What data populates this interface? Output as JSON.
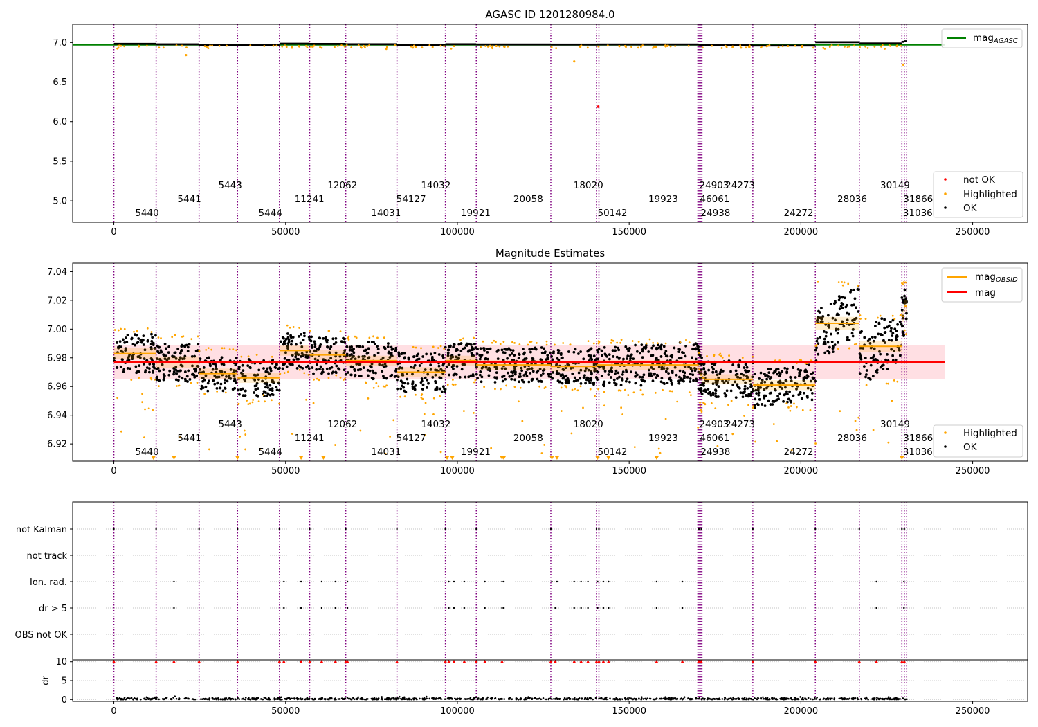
{
  "colors": {
    "ok": "#000000",
    "highlighted": "#ffa500",
    "not_ok": "#ff0000",
    "agasc_line": "#008000",
    "mean_line": "#ff0000",
    "band": "#ffc0c8",
    "obs_line": "#800080",
    "obsid_mag": "#ffa500"
  },
  "chart_data": [
    {
      "type": "scatter",
      "title": "AGASC ID 1201280984.0",
      "xlim": [
        -12000,
        266000
      ],
      "ylim": [
        4.73,
        7.23
      ],
      "xticks": [
        0,
        50000,
        100000,
        150000,
        200000,
        250000
      ],
      "yticks": [
        5.0,
        5.5,
        6.0,
        6.5,
        7.0
      ],
      "ytick_labels": [
        "5.0",
        "5.5",
        "6.0",
        "6.5",
        "7.0"
      ],
      "grid": false,
      "mag_agasc": 6.97,
      "legend_top": {
        "placement": "upper right",
        "entries": [
          "mag_AGASC"
        ],
        "main": "mag",
        "sub": "AGASC"
      },
      "legend_bottom": {
        "placement": "lower right",
        "entries": [
          "not OK",
          "Highlighted",
          "OK"
        ]
      },
      "outlier_not_ok": {
        "x": 141000,
        "y": 6.19
      }
    },
    {
      "type": "scatter",
      "title": "Magnitude Estimates",
      "xlim": [
        -12000,
        266000
      ],
      "ylim": [
        6.908,
        7.046
      ],
      "xticks": [
        0,
        50000,
        100000,
        150000,
        200000,
        250000
      ],
      "yticks": [
        6.92,
        6.94,
        6.96,
        6.98,
        7.0,
        7.02,
        7.04
      ],
      "ytick_labels": [
        "6.92",
        "6.94",
        "6.96",
        "6.98",
        "7.00",
        "7.02",
        "7.04"
      ],
      "grid": false,
      "mag_mean": 6.977,
      "mag_band": [
        6.965,
        6.989
      ],
      "legend_top": {
        "placement": "upper right",
        "entries": [
          "mag_OBSID",
          "mag"
        ],
        "main": "mag",
        "sub": "OBSID",
        "second": "mag"
      },
      "legend_bottom": {
        "placement": "lower right",
        "entries": [
          "Highlighted",
          "OK"
        ]
      },
      "segments": [
        {
          "obsid": "5440",
          "x0": 0,
          "x1": 12300,
          "mean": 6.983,
          "spread": 0.008,
          "upper": 6.998,
          "lower": 6.968,
          "tilt": 0
        },
        {
          "obsid": "5441",
          "x0": 12300,
          "x1": 24800,
          "mean": 6.977,
          "spread": 0.008,
          "upper": 6.993,
          "lower": 6.963,
          "tilt": 0
        },
        {
          "obsid": "5443",
          "x0": 24800,
          "x1": 36000,
          "mean": 6.969,
          "spread": 0.007,
          "upper": 6.984,
          "lower": 6.957,
          "tilt": 0
        },
        {
          "obsid": "5444",
          "x0": 36000,
          "x1": 48200,
          "mean": 6.966,
          "spread": 0.007,
          "upper": 6.98,
          "lower": 6.951,
          "tilt": 0
        },
        {
          "obsid": "11241",
          "x0": 48200,
          "x1": 57000,
          "mean": 6.985,
          "spread": 0.007,
          "upper": 7.0,
          "lower": 6.972,
          "tilt": 0
        },
        {
          "obsid": "12062",
          "x0": 57000,
          "x1": 67500,
          "mean": 6.982,
          "spread": 0.007,
          "upper": 6.997,
          "lower": 6.968,
          "tilt": 0
        },
        {
          "obsid": "14031",
          "x0": 67500,
          "x1": 82400,
          "mean": 6.978,
          "spread": 0.007,
          "upper": 6.992,
          "lower": 6.963,
          "tilt": 0
        },
        {
          "obsid": "14032",
          "x0": 82400,
          "x1": 96500,
          "mean": 6.97,
          "spread": 0.007,
          "upper": 6.986,
          "lower": 6.955,
          "tilt": 0
        },
        {
          "obsid": "19921",
          "x0": 96500,
          "x1": 105500,
          "mean": 6.978,
          "spread": 0.007,
          "upper": 6.992,
          "lower": 6.965,
          "tilt": 0
        },
        {
          "obsid": "20058",
          "x0": 105500,
          "x1": 127200,
          "mean": 6.975,
          "spread": 0.007,
          "upper": 6.989,
          "lower": 6.962,
          "tilt": 0
        },
        {
          "obsid": "18020",
          "x0": 127200,
          "x1": 140500,
          "mean": 6.974,
          "spread": 0.007,
          "upper": 6.989,
          "lower": 6.961,
          "tilt": 0
        },
        {
          "obsid": "50142",
          "x0": 140500,
          "x1": 141200,
          "mean": 6.975,
          "spread": 0.007,
          "upper": 6.989,
          "lower": 6.962,
          "tilt": 0
        },
        {
          "obsid": "19923",
          "x0": 141200,
          "x1": 170200,
          "mean": 6.975,
          "spread": 0.007,
          "upper": 6.99,
          "lower": 6.958,
          "tilt": -0.004
        },
        {
          "obsid": "24903",
          "x0": 170200,
          "x1": 170700,
          "mean": 6.972,
          "spread": 0.007,
          "upper": 6.982,
          "lower": 6.95,
          "tilt": 0
        },
        {
          "obsid": "46061",
          "x0": 170700,
          "x1": 171200,
          "mean": 6.968,
          "spread": 0.007,
          "upper": 6.975,
          "lower": 6.945,
          "tilt": 0
        },
        {
          "obsid": "24938",
          "x0": 171200,
          "x1": 172000,
          "mean": 6.966,
          "spread": 0.007,
          "upper": 6.975,
          "lower": 6.95,
          "tilt": 0
        },
        {
          "obsid": "24273",
          "x0": 172000,
          "x1": 186000,
          "mean": 6.965,
          "spread": 0.007,
          "upper": 6.98,
          "lower": 6.951,
          "tilt": 0
        },
        {
          "obsid": "24272",
          "x0": 186000,
          "x1": 204200,
          "mean": 6.961,
          "spread": 0.007,
          "upper": 6.976,
          "lower": 6.947,
          "tilt": -0.006
        },
        {
          "obsid": "28036",
          "x0": 204200,
          "x1": 217000,
          "mean": 7.004,
          "spread": 0.009,
          "upper": 7.03,
          "lower": 6.99,
          "tilt": -0.02
        },
        {
          "obsid": "30149",
          "x0": 217000,
          "x1": 229400,
          "mean": 6.988,
          "spread": 0.008,
          "upper": 7.007,
          "lower": 6.965,
          "tilt": -0.018
        },
        {
          "obsid": "31866",
          "x0": 229400,
          "x1": 230100,
          "mean": 7.009,
          "spread": 0.008,
          "upper": 7.03,
          "lower": 6.998,
          "tilt": 0
        },
        {
          "obsid": "31036",
          "x0": 230100,
          "x1": 230800,
          "mean": 7.016,
          "spread": 0.008,
          "upper": 7.032,
          "lower": 7.0,
          "tilt": 0
        }
      ]
    },
    {
      "type": "scatter",
      "title": "",
      "xlim": [
        -12000,
        266000
      ],
      "xticks": [
        0,
        50000,
        100000,
        150000,
        200000,
        250000
      ],
      "grid": true,
      "flags": [
        "not Kalman",
        "not track",
        "Ion. rad.",
        "dr > 5",
        "OBS not OK"
      ],
      "flag_points": {
        "not Kalman": [
          0,
          12300,
          24800,
          36000,
          48200,
          57000,
          67500,
          82400,
          96500,
          105500,
          127200,
          140500,
          141200,
          170200,
          170500,
          171000,
          186000,
          204200,
          217000,
          229400,
          230100
        ],
        "not track": [],
        "Ion. rad.": [
          17500,
          49500,
          54500,
          60500,
          64500,
          68000,
          97500,
          99000,
          102000,
          108000,
          113000,
          113500,
          127500,
          129000,
          134000,
          136000,
          138000,
          140800,
          142500,
          144000,
          158000,
          165500,
          222000,
          230000
        ],
        "dr > 5": [
          17500,
          49500,
          54500,
          60500,
          64500,
          68000,
          97500,
          99000,
          102000,
          108000,
          113000,
          113500,
          128500,
          134000,
          136000,
          138000,
          140800,
          142500,
          144000,
          158000,
          165500,
          222000,
          230000
        ],
        "OBS not OK": []
      },
      "dr_ylabel": "dr",
      "dr_ylim": [
        -0.5,
        10.5
      ],
      "dr_yticks": [
        0,
        5,
        10
      ],
      "dr_clip_markers": [
        0,
        12300,
        17500,
        24800,
        36000,
        48200,
        49500,
        54500,
        57000,
        60500,
        64500,
        67500,
        68000,
        82400,
        96500,
        97500,
        99000,
        102000,
        105500,
        108000,
        113000,
        127200,
        128500,
        134000,
        136000,
        138000,
        140500,
        141200,
        142500,
        144000,
        158000,
        165500,
        170200,
        170500,
        171000,
        186000,
        204200,
        217000,
        222000,
        229400,
        230100
      ]
    }
  ],
  "obs_boundaries": [
    0,
    12300,
    24800,
    36000,
    48200,
    57000,
    67500,
    82400,
    96500,
    105500,
    127200,
    140500,
    141200,
    170000,
    170300,
    170600,
    170900,
    171200,
    186000,
    204200,
    217000,
    229400,
    230100,
    230800
  ],
  "obs_labels": [
    {
      "text": "5440",
      "x": 6200,
      "row": 3
    },
    {
      "text": "5441",
      "x": 18500,
      "row": 2
    },
    {
      "text": "5443",
      "x": 30400,
      "row": 1
    },
    {
      "text": "5444",
      "x": 42100,
      "row": 3
    },
    {
      "text": "11241",
      "x": 52600,
      "row": 2
    },
    {
      "text": "12062",
      "x": 62200,
      "row": 1
    },
    {
      "text": "14031",
      "x": 74900,
      "row": 3
    },
    {
      "text": "54127",
      "x": 82200,
      "row": 2
    },
    {
      "text": "14032",
      "x": 89400,
      "row": 1
    },
    {
      "text": "19921",
      "x": 101000,
      "row": 3
    },
    {
      "text": "20058",
      "x": 116300,
      "row": 2
    },
    {
      "text": "18020",
      "x": 133800,
      "row": 1
    },
    {
      "text": "50142",
      "x": 140800,
      "row": 3
    },
    {
      "text": "19923",
      "x": 155600,
      "row": 2
    },
    {
      "text": "24903",
      "x": 170400,
      "row": 1
    },
    {
      "text": "46061",
      "x": 170600,
      "row": 2
    },
    {
      "text": "24938",
      "x": 170800,
      "row": 3
    },
    {
      "text": "24273",
      "x": 178000,
      "row": 1
    },
    {
      "text": "24272",
      "x": 195000,
      "row": 3
    },
    {
      "text": "28036",
      "x": 210600,
      "row": 2
    },
    {
      "text": "30149",
      "x": 223100,
      "row": 1
    },
    {
      "text": "31866",
      "x": 229800,
      "row": 2
    },
    {
      "text": "31036",
      "x": 229700,
      "row": 3
    }
  ]
}
